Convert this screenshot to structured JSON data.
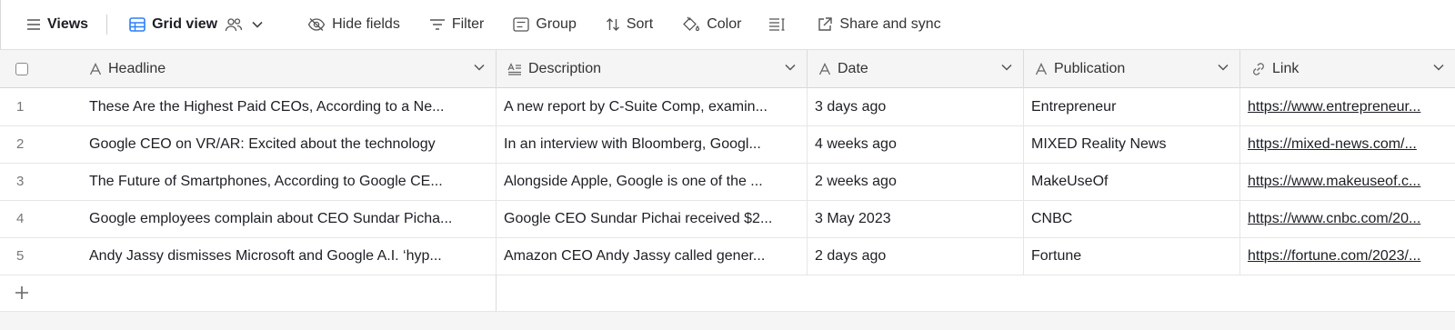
{
  "toolbar": {
    "views_label": "Views",
    "grid_view_label": "Grid view",
    "hide_fields_label": "Hide fields",
    "filter_label": "Filter",
    "group_label": "Group",
    "sort_label": "Sort",
    "color_label": "Color",
    "share_label": "Share and sync"
  },
  "columns": [
    {
      "label": "Headline",
      "icon": "text-icon"
    },
    {
      "label": "Description",
      "icon": "long-text-icon"
    },
    {
      "label": "Date",
      "icon": "text-icon"
    },
    {
      "label": "Publication",
      "icon": "text-icon"
    },
    {
      "label": "Link",
      "icon": "link-icon"
    }
  ],
  "rows": [
    {
      "num": "1",
      "headline": "These Are the Highest Paid CEOs, According to a Ne...",
      "description": "A new report by C-Suite Comp, examin...",
      "date": "3 days ago",
      "publication": "Entrepreneur",
      "link": "https://www.entrepreneur..."
    },
    {
      "num": "2",
      "headline": "Google CEO on VR/AR: Excited about the technology",
      "description": "In an interview with Bloomberg, Googl...",
      "date": "4 weeks ago",
      "publication": "MIXED Reality News",
      "link": "https://mixed-news.com/..."
    },
    {
      "num": "3",
      "headline": "The Future of Smartphones, According to Google CE...",
      "description": "Alongside Apple, Google is one of the ...",
      "date": "2 weeks ago",
      "publication": "MakeUseOf",
      "link": "https://www.makeuseof.c..."
    },
    {
      "num": "4",
      "headline": "Google employees complain about CEO Sundar Picha...",
      "description": "Google CEO Sundar Pichai received $2...",
      "date": "3 May 2023",
      "publication": "CNBC",
      "link": "https://www.cnbc.com/20..."
    },
    {
      "num": "5",
      "headline": "Andy Jassy dismisses Microsoft and Google A.I. ‘hyp...",
      "description": "Amazon CEO Andy Jassy called gener...",
      "date": "2 days ago",
      "publication": "Fortune",
      "link": "https://fortune.com/2023/..."
    }
  ]
}
